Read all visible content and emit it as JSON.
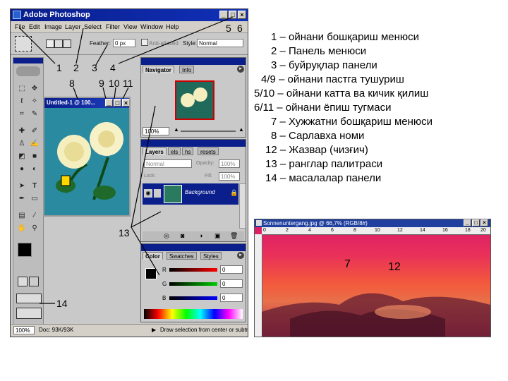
{
  "window": {
    "title": "Adobe Photoshop",
    "buttons": [
      "_",
      "□",
      "×"
    ]
  },
  "menu": [
    "File",
    "Edit",
    "Image",
    "Layer",
    "Select",
    "Filter",
    "View",
    "Window",
    "Help"
  ],
  "options_bar": {
    "feather_label": "Feather:",
    "feather_value": "0 px",
    "antialiased_label": "Anti-aliased",
    "style_label": "Style:",
    "style_value": "Normal"
  },
  "document": {
    "title": "Untitled-1 @ 100..."
  },
  "navigator": {
    "tabs": [
      "Navigator",
      "Info"
    ],
    "zoom": "100%"
  },
  "layers": {
    "tabs": [
      "Layers",
      "els",
      "hs",
      "resets"
    ],
    "blend_mode": "Normal",
    "opacity_label": "Opacity:",
    "opacity_value": "100%",
    "lock_label": "Lock:",
    "fill_label": "Fill:",
    "fill_value": "100%",
    "layer_name": "Background"
  },
  "color": {
    "tabs": [
      "Color",
      "Swatches",
      "Styles"
    ],
    "channels": [
      {
        "label": "R",
        "value": "0"
      },
      {
        "label": "G",
        "value": "0"
      },
      {
        "label": "B",
        "value": "0"
      }
    ]
  },
  "status": {
    "zoom": "100%",
    "doc": "Doc: 93K/93K",
    "hint": "Draw selection from center or subtra"
  },
  "callouts": {
    "n1": "1",
    "n2": "2",
    "n3": "3",
    "n4": "4",
    "n5": "5",
    "n6": "6",
    "n8": "8",
    "n9": "9",
    "n10": "10",
    "n11": "11",
    "n13": "13",
    "n14": "14",
    "n7": "7",
    "n12": "12"
  },
  "legend": [
    "1 – ойнани бошқариш менюси",
    "2 – Панель менюси",
    "3 – буйруқлар панели",
    "4/9 – ойнани пастга тушуриш",
    "5/10 – ойнани катта ва кичик қилиш",
    "6/11 – ойнани ёпиш тугмаси",
    "7 – Хужжатни бошқариш менюси",
    "8 – Сарлавха номи",
    "12 – Жазвар (чизғич)",
    "13 – ранглар палитраси",
    "14 – масалалар панели"
  ],
  "sunset": {
    "title": "Sonnenuntergang.jpg @ 66,7% (RGB/8#)",
    "ruler_ticks": [
      "0",
      "2",
      "4",
      "6",
      "8",
      "10",
      "12",
      "14",
      "16",
      "18",
      "20"
    ]
  },
  "colors": {
    "titlebar": "#0a1e8c",
    "panel_bg": "#c9c9c9"
  }
}
